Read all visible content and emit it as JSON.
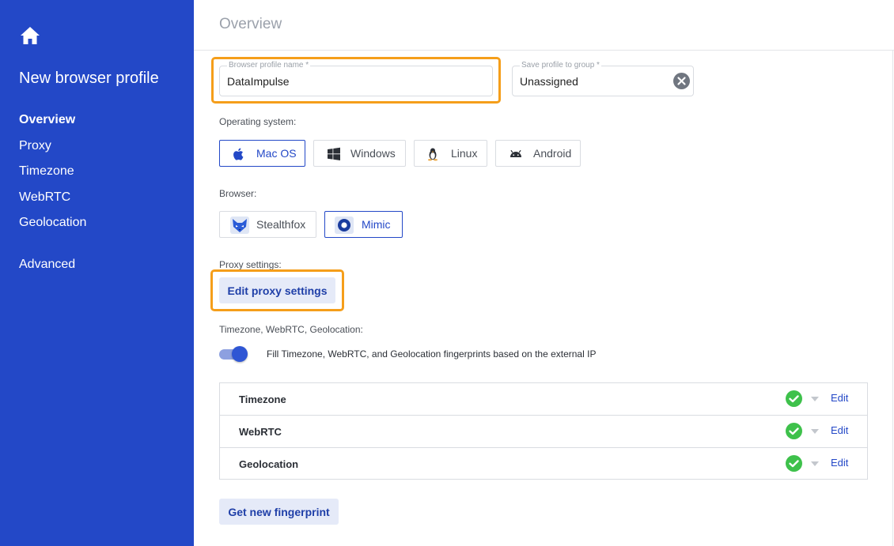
{
  "sidebar": {
    "title": "New browser profile",
    "items": [
      {
        "label": "Overview"
      },
      {
        "label": "Proxy"
      },
      {
        "label": "Timezone"
      },
      {
        "label": "WebRTC"
      },
      {
        "label": "Geolocation"
      },
      {
        "label": "Advanced"
      }
    ]
  },
  "main": {
    "title": "Overview",
    "profile_name": {
      "label": "Browser profile name *",
      "value": "DataImpulse"
    },
    "group": {
      "label": "Save profile to group *",
      "value": "Unassigned"
    },
    "os_label": "Operating system:",
    "os_options": [
      {
        "label": "Mac OS",
        "icon": "apple-icon"
      },
      {
        "label": "Windows",
        "icon": "windows-icon"
      },
      {
        "label": "Linux",
        "icon": "linux-icon"
      },
      {
        "label": "Android",
        "icon": "android-icon"
      }
    ],
    "browser_label": "Browser:",
    "browser_options": [
      {
        "label": "Stealthfox",
        "icon": "stealthfox-icon"
      },
      {
        "label": "Mimic",
        "icon": "mimic-icon"
      }
    ],
    "proxy_label": "Proxy settings:",
    "proxy_button": "Edit proxy settings",
    "tz_label": "Timezone, WebRTC, Geolocation:",
    "toggle_text": "Fill Timezone, WebRTC, and Geolocation fingerprints based on the external IP",
    "fingerprints": [
      {
        "name": "Timezone",
        "edit": "Edit"
      },
      {
        "name": "WebRTC",
        "edit": "Edit"
      },
      {
        "name": "Geolocation",
        "edit": "Edit"
      }
    ],
    "new_fp_button": "Get new fingerprint"
  },
  "colors": {
    "sidebar": "#2348c7",
    "accent": "#2348c7",
    "highlight": "#f59e1a",
    "check": "#3ec14b"
  }
}
